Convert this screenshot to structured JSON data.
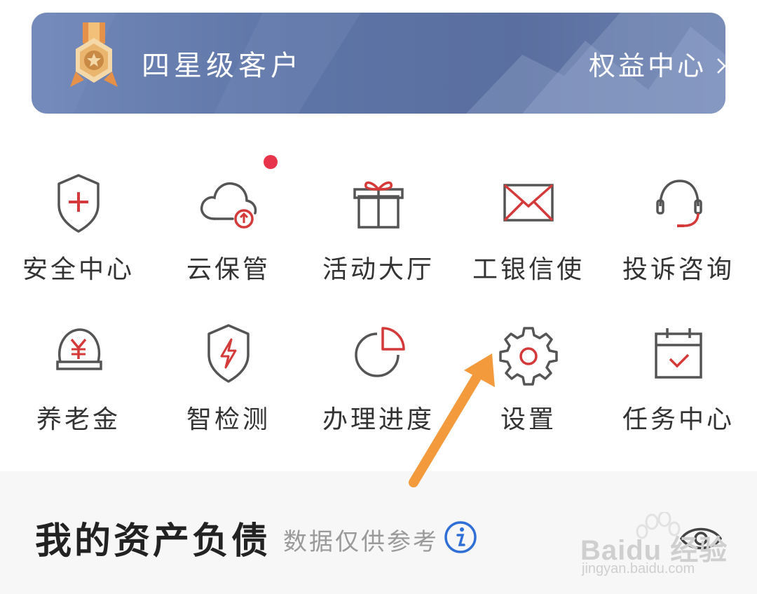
{
  "banner": {
    "title": "四星级客户",
    "link_label": "权益中心",
    "badge_icon": "medal-star-icon",
    "chevron_icon": "chevron-right-icon"
  },
  "grid": {
    "items": [
      {
        "label": "安全中心",
        "icon": "shield-plus-icon"
      },
      {
        "label": "云保管",
        "icon": "cloud-upload-icon",
        "notification_dot": true
      },
      {
        "label": "活动大厅",
        "icon": "gift-icon"
      },
      {
        "label": "工银信使",
        "icon": "envelope-icon"
      },
      {
        "label": "投诉咨询",
        "icon": "headset-icon"
      },
      {
        "label": "养老金",
        "icon": "yuan-coin-icon"
      },
      {
        "label": "智检测",
        "icon": "shield-bolt-icon"
      },
      {
        "label": "办理进度",
        "icon": "pie-chart-icon"
      },
      {
        "label": "设置",
        "icon": "gear-icon"
      },
      {
        "label": "任务中心",
        "icon": "calendar-check-icon"
      }
    ]
  },
  "assets": {
    "title": "我的资产负债",
    "note": "数据仅供参考",
    "info_icon": "info-icon",
    "eye_icon": "eye-icon"
  },
  "watermark": {
    "text": "Baidu 经验",
    "url": "jingyan.baidu.com"
  },
  "colors": {
    "banner_bg": "#5d74a6",
    "accent_red": "#d43a3a",
    "notification_dot": "#e8344a",
    "annotation_arrow": "#f39a3c",
    "info_blue": "#2f6fd6"
  }
}
